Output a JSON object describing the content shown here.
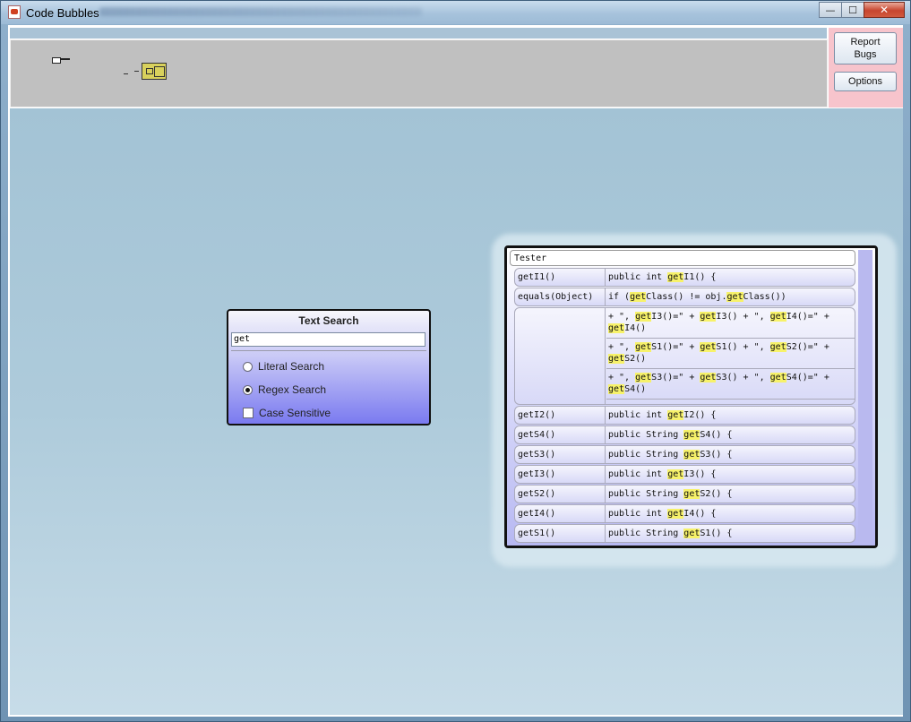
{
  "window": {
    "title": "Code Bubbles",
    "controls": {
      "minimize": "—",
      "maximize": "☐",
      "close": "✕"
    }
  },
  "side_buttons": {
    "report": "Report\nBugs",
    "options": "Options"
  },
  "text_search": {
    "title": "Text Search",
    "query": "get",
    "options": [
      {
        "label": "Literal Search",
        "type": "radio",
        "selected": false
      },
      {
        "label": "Regex Search",
        "type": "radio",
        "selected": true
      },
      {
        "label": "Case Sensitive",
        "type": "checkbox",
        "selected": false
      }
    ]
  },
  "results": {
    "header": "Tester",
    "rows": [
      {
        "name": "getI1()",
        "code": [
          {
            "t": "public int "
          },
          {
            "t": "get",
            "h": true
          },
          {
            "t": "I1() {"
          }
        ]
      },
      {
        "name": "equals(Object)",
        "code": [
          {
            "t": "if ("
          },
          {
            "t": "get",
            "h": true
          },
          {
            "t": "Class() != obj."
          },
          {
            "t": "get",
            "h": true
          },
          {
            "t": "Class())"
          }
        ]
      },
      {
        "name": "",
        "subs": [
          [
            {
              "t": "+ \", "
            },
            {
              "t": "get",
              "h": true
            },
            {
              "t": "I3()=\" + "
            },
            {
              "t": "get",
              "h": true
            },
            {
              "t": "I3() + \", "
            },
            {
              "t": "get",
              "h": true
            },
            {
              "t": "I4()=\" + "
            },
            {
              "t": "get",
              "h": true
            },
            {
              "t": "I4()"
            }
          ],
          [
            {
              "t": "+ \", "
            },
            {
              "t": "get",
              "h": true
            },
            {
              "t": "S1()=\" + "
            },
            {
              "t": "get",
              "h": true
            },
            {
              "t": "S1() + \", "
            },
            {
              "t": "get",
              "h": true
            },
            {
              "t": "S2()=\" + "
            },
            {
              "t": "get",
              "h": true
            },
            {
              "t": "S2()"
            }
          ],
          [
            {
              "t": "+ \", "
            },
            {
              "t": "get",
              "h": true
            },
            {
              "t": "S3()=\" + "
            },
            {
              "t": "get",
              "h": true
            },
            {
              "t": "S3() + \", "
            },
            {
              "t": "get",
              "h": true
            },
            {
              "t": "S4()=\" + "
            },
            {
              "t": "get",
              "h": true
            },
            {
              "t": "S4()"
            }
          ]
        ]
      },
      {
        "name": "getI2()",
        "code": [
          {
            "t": "public int "
          },
          {
            "t": "get",
            "h": true
          },
          {
            "t": "I2() {"
          }
        ]
      },
      {
        "name": "getS4()",
        "code": [
          {
            "t": "public String "
          },
          {
            "t": "get",
            "h": true
          },
          {
            "t": "S4() {"
          }
        ]
      },
      {
        "name": "getS3()",
        "code": [
          {
            "t": "public String "
          },
          {
            "t": "get",
            "h": true
          },
          {
            "t": "S3() {"
          }
        ]
      },
      {
        "name": "getI3()",
        "code": [
          {
            "t": "public int "
          },
          {
            "t": "get",
            "h": true
          },
          {
            "t": "I3() {"
          }
        ]
      },
      {
        "name": "getS2()",
        "code": [
          {
            "t": "public String "
          },
          {
            "t": "get",
            "h": true
          },
          {
            "t": "S2() {"
          }
        ]
      },
      {
        "name": "getI4()",
        "code": [
          {
            "t": "public int "
          },
          {
            "t": "get",
            "h": true
          },
          {
            "t": "I4() {"
          }
        ]
      },
      {
        "name": "getS1()",
        "code": [
          {
            "t": "public String "
          },
          {
            "t": "get",
            "h": true
          },
          {
            "t": "S1() {"
          }
        ]
      }
    ]
  }
}
